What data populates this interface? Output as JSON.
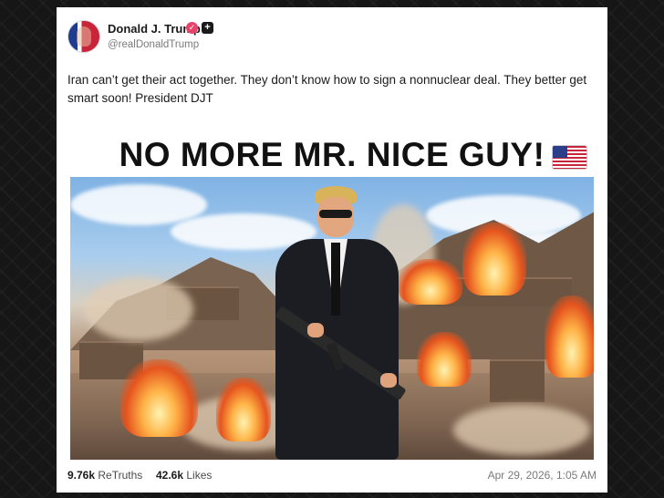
{
  "post": {
    "author_name": "Donald J. Trump",
    "handle": "@realDonaldTrump",
    "verified_icon": "check-badge-icon",
    "plus_icon": "plus-icon",
    "text": "Iran can’t get their act together. They don’t know how to sign a nonnuclear deal. They better get smart soon! President DJT",
    "image_headline": "NO MORE MR. NICE GUY!",
    "flag_icon": "us-flag-icon"
  },
  "stats": {
    "retruths_count": "9.76k",
    "retruths_label": "ReTruths",
    "likes_count": "42.6k",
    "likes_label": "Likes",
    "timestamp": "Apr 29, 2026, 1:05 AM"
  },
  "colors": {
    "background": "#161616",
    "card": "#ffffff",
    "verified_badge": "#e8436a",
    "text": "#1a1a1a",
    "muted": "#7a7a7a"
  }
}
